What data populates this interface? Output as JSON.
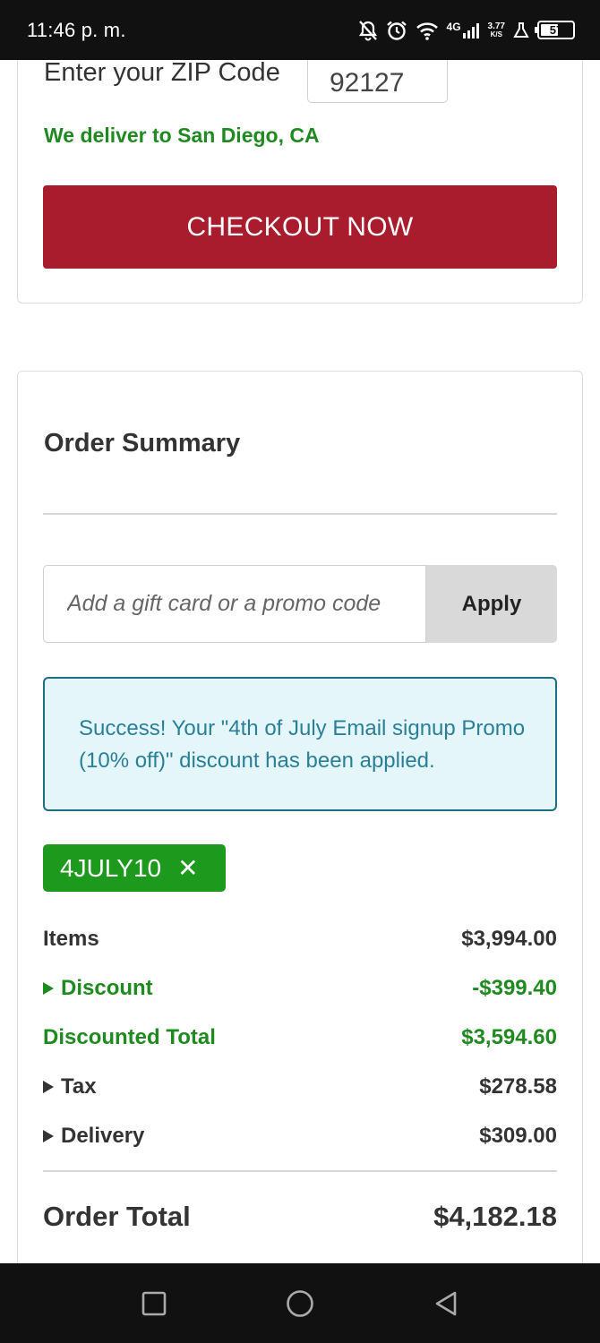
{
  "status_bar": {
    "time": "11:46 p. m.",
    "network": "4G",
    "speed_value": "3.77",
    "speed_unit": "K/S",
    "battery": "57",
    "battery_level": 0.57
  },
  "delivery": {
    "zip_label": "Enter your ZIP Code",
    "zip_value": "92127",
    "message": "We deliver to San Diego, CA",
    "checkout_label": "CHECKOUT NOW"
  },
  "summary": {
    "title": "Order Summary",
    "promo_placeholder": "Add a gift card or a promo code",
    "apply_label": "Apply",
    "success_message": "Success! Your \"4th of July Email signup Promo (10% off)\" discount has been applied.",
    "promo_code": "4JULY10",
    "chip_remove": "✕",
    "lines": {
      "items": {
        "label": "Items",
        "value": "$3,994.00"
      },
      "discount": {
        "label": "Discount",
        "value": "-$399.40"
      },
      "discounted_total": {
        "label": "Discounted Total",
        "value": "$3,594.60"
      },
      "tax": {
        "label": "Tax",
        "value": "$278.58"
      },
      "delivery": {
        "label": "Delivery",
        "value": "$309.00"
      }
    },
    "order_total": {
      "label": "Order Total",
      "value": "$4,182.18"
    }
  },
  "colors": {
    "checkout": "#a81c2e",
    "success_green": "#1f8a1f",
    "chip_green": "#1d9a1d",
    "info_bg": "#e5f6fb",
    "info_border": "#1e6e85"
  }
}
